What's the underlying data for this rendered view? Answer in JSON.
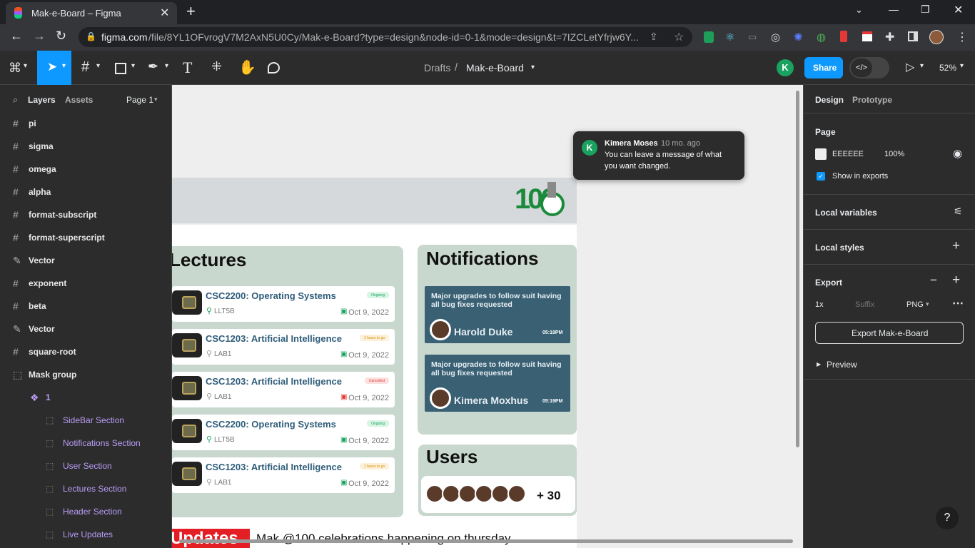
{
  "browser": {
    "tab_title": "Mak-e-Board – Figma",
    "url_domain": "figma.com",
    "url_path": "/file/8YL1OFvrogV7M2AxN5U0Cy/Mak-e-Board?type=design&node-id=0-1&mode=design&t=7IZCLetYfrjw6Y..."
  },
  "figma": {
    "breadcrumb_parent": "Drafts",
    "breadcrumb_file": "Mak-e-Board",
    "avatar_letter": "K",
    "share_label": "Share",
    "zoom": "52%"
  },
  "left": {
    "tab_layers": "Layers",
    "tab_assets": "Assets",
    "page": "Page 1",
    "layers": [
      {
        "icon": "#",
        "label": "pi"
      },
      {
        "icon": "#",
        "label": "sigma"
      },
      {
        "icon": "#",
        "label": "omega"
      },
      {
        "icon": "#",
        "label": "alpha"
      },
      {
        "icon": "#",
        "label": "format-subscript"
      },
      {
        "icon": "#",
        "label": "format-superscript"
      },
      {
        "icon": "✎",
        "label": "Vector"
      },
      {
        "icon": "#",
        "label": "exponent"
      },
      {
        "icon": "#",
        "label": "beta"
      },
      {
        "icon": "✎",
        "label": "Vector"
      },
      {
        "icon": "#",
        "label": "square-root"
      },
      {
        "icon": "⬚",
        "label": "Mask group"
      },
      {
        "icon": "❖",
        "label": "1"
      }
    ],
    "sub_layers": [
      "SideBar Section",
      "Notifications Section",
      "User Section",
      "Lectures Section",
      "Header Section",
      "Live Updates"
    ]
  },
  "right": {
    "tab_design": "Design",
    "tab_prototype": "Prototype",
    "page_label": "Page",
    "page_color": "EEEEEE",
    "page_opacity": "100%",
    "show_exports": "Show in exports",
    "local_variables": "Local variables",
    "local_styles": "Local styles",
    "export_label": "Export",
    "export_scale": "1x",
    "export_suffix_placeholder": "Suffix",
    "export_format": "PNG",
    "export_button": "Export Mak-e-Board",
    "preview_label": "Preview"
  },
  "comment": {
    "avatar": "K",
    "author": "Kimera Moses",
    "time": "10 mo. ago",
    "text_line1": "You can leave a message of what",
    "text_line2": "you want changed."
  },
  "design": {
    "logo_text": "100",
    "lectures_heading": "Lectures",
    "lectures": [
      {
        "title": "CSC2200: Operating Systems",
        "location": "LLT5B",
        "date": "Oct 9, 2022",
        "status": "Ongoing"
      },
      {
        "title": "CSC1203: Artificial Intelligence",
        "location": "LAB1",
        "date": "Oct 9, 2022",
        "status": "1 hours to go"
      },
      {
        "title": "CSC1203: Artificial Intelligence",
        "location": "LAB1",
        "date": "Oct 9, 2022",
        "status": "Cancelled"
      },
      {
        "title": "CSC2200: Operating Systems",
        "location": "LLT5B",
        "date": "Oct 9, 2022",
        "status": "Ongoing"
      },
      {
        "title": "CSC1203: Artificial Intelligence",
        "location": "LAB1",
        "date": "Oct 9, 2022",
        "status": "1 hours to go"
      }
    ],
    "notifications_heading": "Notifications",
    "notifications": [
      {
        "message": "Major upgrades to follow suit having all bug fixes requested",
        "name": "Harold Duke",
        "time": "05:19PM"
      },
      {
        "message": "Major upgrades to follow suit having all bug fixes requested",
        "name": "Kimera Moxhus",
        "time": "05:19PM"
      }
    ],
    "users_heading": "Users",
    "users_more": "+ 30",
    "updates_heading": "Updates",
    "updates_text": "Mak @100 celebrations happening on thursday"
  },
  "help": "?",
  "colors": {
    "accent": "#0d99ff",
    "green": "#1aa260",
    "panel": "#2c2c2c",
    "section": "#c9d8cf",
    "notif": "#3a6074"
  }
}
